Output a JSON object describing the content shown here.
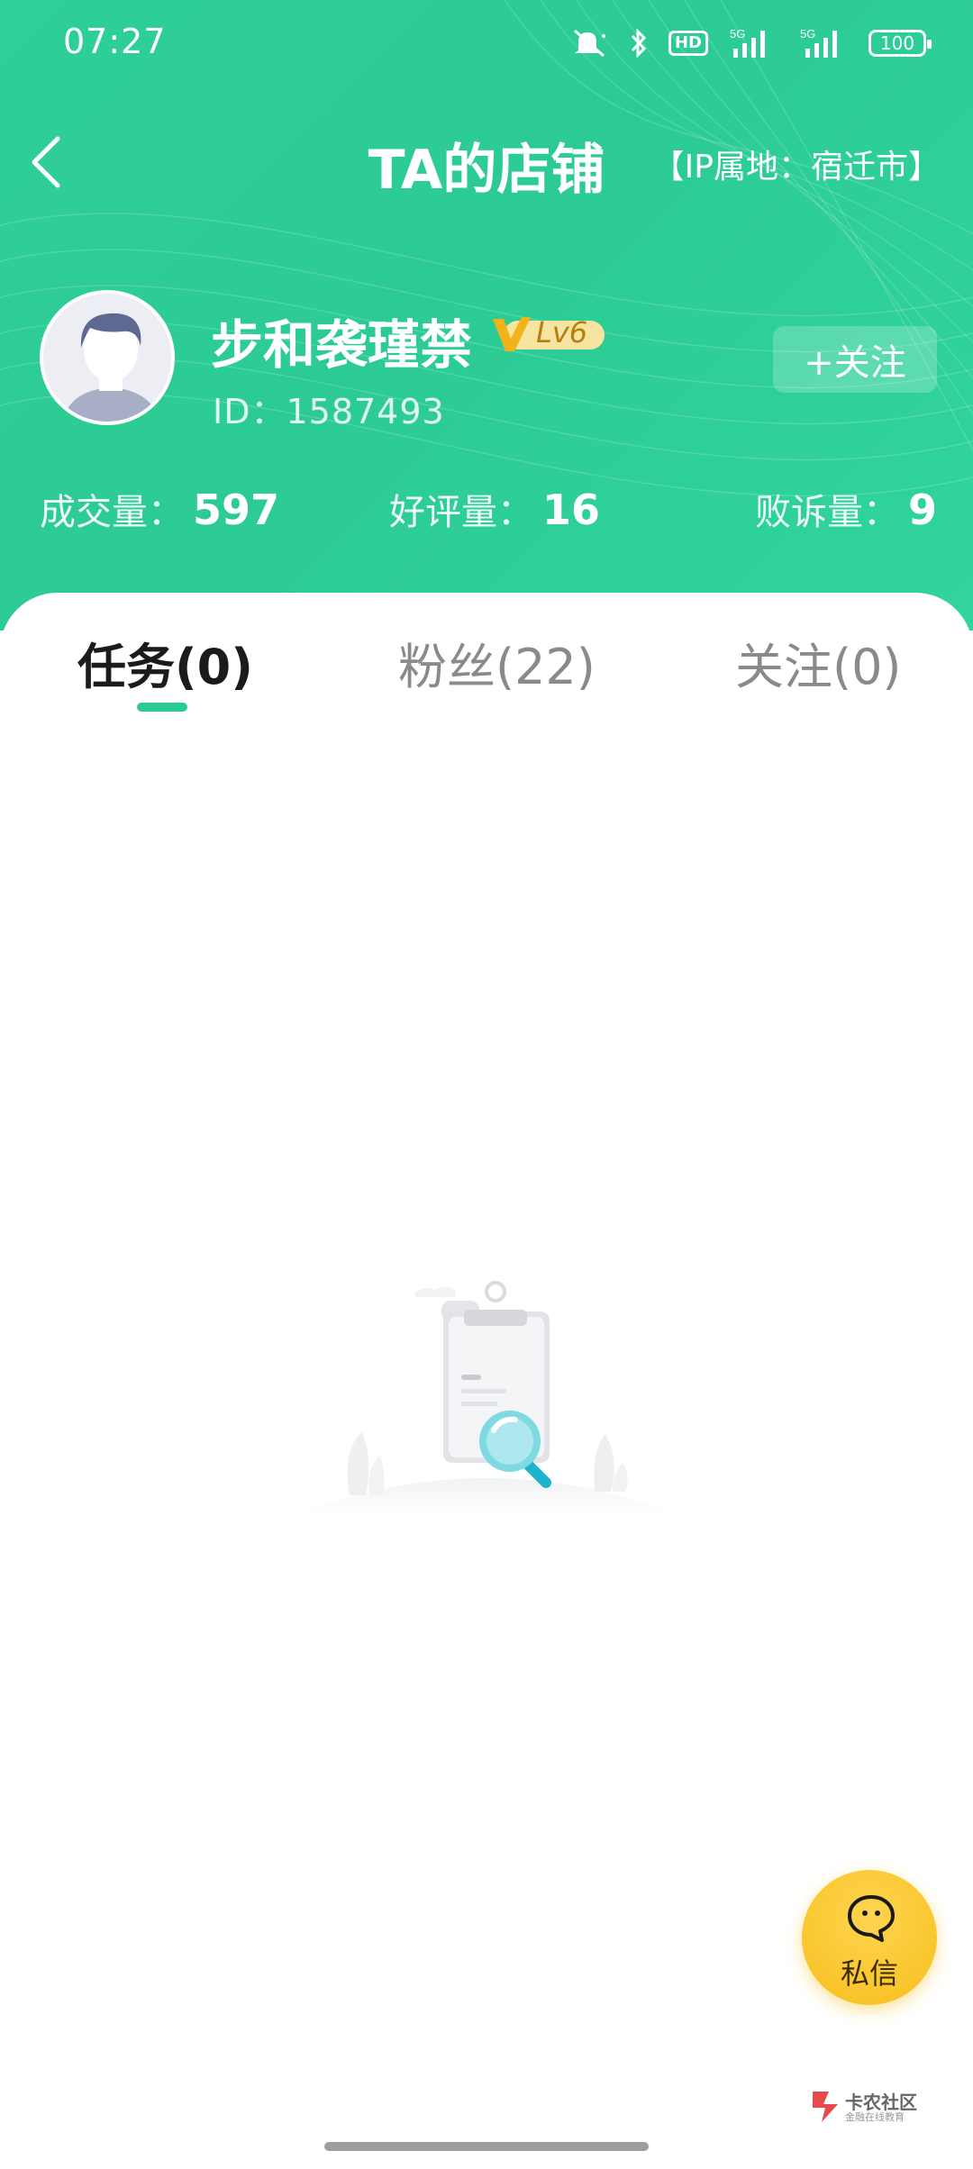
{
  "status_bar": {
    "time": "07:27",
    "hd_label": "HD",
    "signal_1": "5G",
    "signal_2": "5G",
    "battery": "100"
  },
  "nav": {
    "title": "TA的店铺",
    "ip_location": "【IP属地：宿迁市】"
  },
  "profile": {
    "name": "步和袭瑾禁",
    "level": "Lv6",
    "id_text": "ID：1587493",
    "follow_label": "+关注"
  },
  "stats": [
    {
      "label": "成交量：",
      "value": "597"
    },
    {
      "label": "好评量：",
      "value": "16"
    },
    {
      "label": "败诉量：",
      "value": "9"
    }
  ],
  "tabs": [
    {
      "label": "任务(0)",
      "active": true
    },
    {
      "label": "粉丝(22)",
      "active": false
    },
    {
      "label": "关注(0)",
      "active": false
    }
  ],
  "fab": {
    "label": "私信"
  },
  "watermark": {
    "name": "卡农社区",
    "sub": "金融在线教育"
  },
  "colors": {
    "brand": "#2ccb93",
    "fab": "#f7bf1d"
  }
}
